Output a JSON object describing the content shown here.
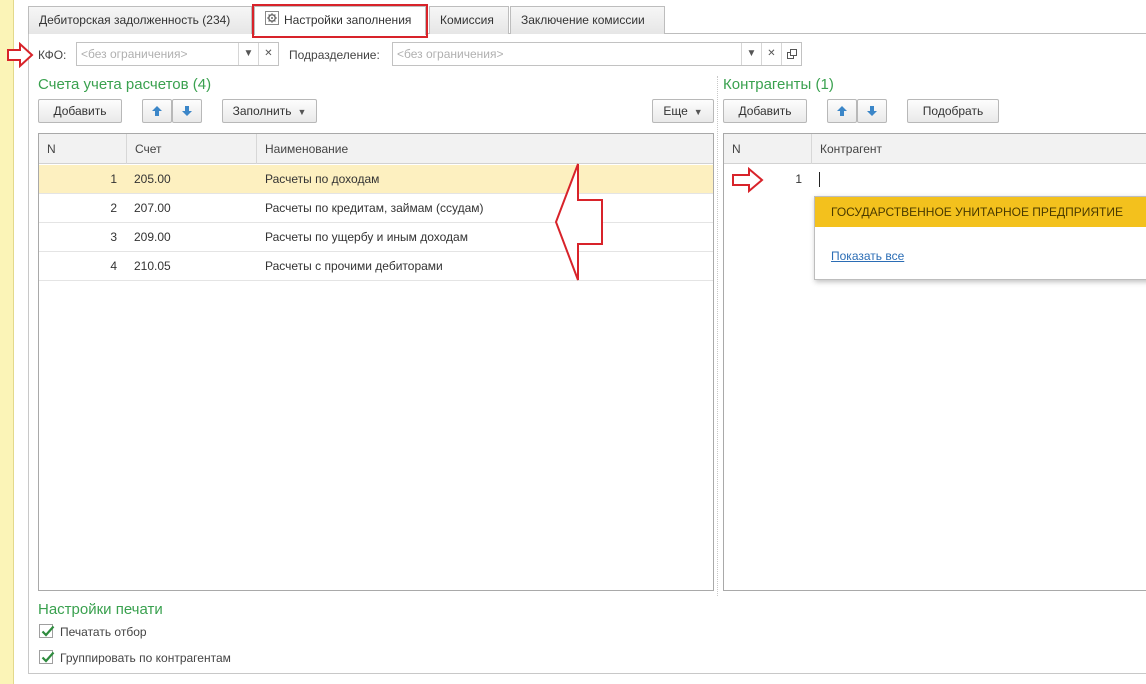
{
  "tabs": [
    {
      "label": "Дебиторская задолженность (234)"
    },
    {
      "label": "Настройки заполнения"
    },
    {
      "label": "Комиссия"
    },
    {
      "label": "Заключение комиссии"
    }
  ],
  "filters": {
    "kfo_label": "КФО:",
    "kfo_placeholder": "<без ограничения>",
    "division_label": "Подразделение:",
    "division_placeholder": "<без ограничения>"
  },
  "accounts": {
    "title": "Счета учета расчетов (4)",
    "add_label": "Добавить",
    "fill_label": "Заполнить",
    "more_label": "Еще",
    "columns": [
      "N",
      "Счет",
      "Наименование"
    ],
    "rows": [
      {
        "n": "1",
        "account": "205.00",
        "name": "Расчеты по доходам"
      },
      {
        "n": "2",
        "account": "207.00",
        "name": "Расчеты по кредитам, займам (ссудам)"
      },
      {
        "n": "3",
        "account": "209.00",
        "name": "Расчеты по ущербу и иным доходам"
      },
      {
        "n": "4",
        "account": "210.05",
        "name": "Расчеты с прочими дебиторами"
      }
    ]
  },
  "counterparties": {
    "title": "Контрагенты (1)",
    "add_label": "Добавить",
    "pick_label": "Подобрать",
    "columns": [
      "N",
      "Контрагент"
    ],
    "rows": [
      {
        "n": "1"
      }
    ],
    "suggestion": "ГОСУДАРСТВЕННОЕ УНИТАРНОЕ ПРЕДПРИЯТИЕ",
    "show_all": "Показать все"
  },
  "print": {
    "title": "Настройки печати",
    "print_filter": "Печатать отбор",
    "group_by_counterparty": "Группировать по контрагентам"
  },
  "colors": {
    "accent_green": "#3aa14f",
    "highlight_red": "#d8232a",
    "suggestion_yellow": "#f3c11d"
  }
}
